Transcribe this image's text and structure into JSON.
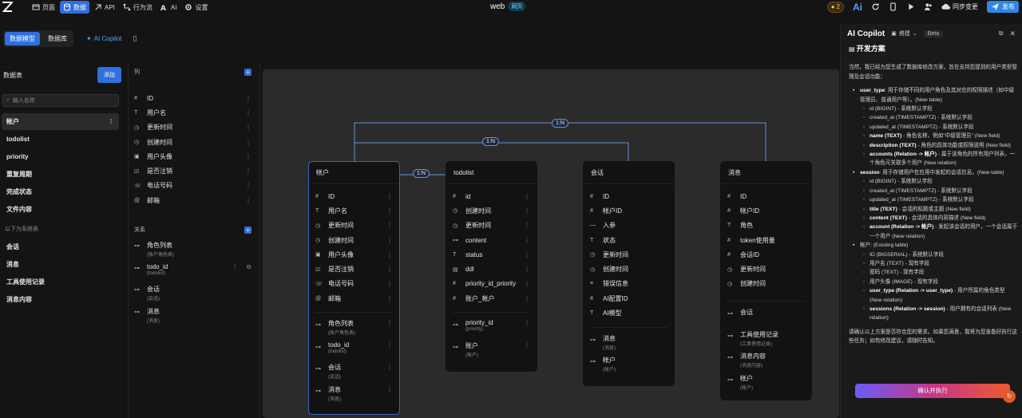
{
  "nav": {
    "items": [
      {
        "label": "页面",
        "icon": "page-icon"
      },
      {
        "label": "数据",
        "icon": "database-icon"
      },
      {
        "label": "API",
        "icon": "api-icon"
      },
      {
        "label": "行为流",
        "icon": "flow-icon"
      },
      {
        "label": "AI",
        "icon": "ai-icon"
      },
      {
        "label": "设置",
        "icon": "gear-icon"
      }
    ],
    "active_index": 1
  },
  "app": {
    "name": "web",
    "badge": "网页"
  },
  "toolbar": {
    "credits": "2",
    "ai": "Ai",
    "sync_label": "同步变更",
    "publish_label": "发布"
  },
  "subtabs": {
    "model": "数据模型",
    "db": "数据库",
    "copilot": "AI Copilot"
  },
  "sidebar": {
    "title": "数据表",
    "add_label": "添加",
    "search_placeholder": "输入名称",
    "tables": [
      "帐户",
      "todolist",
      "priority",
      "重复周期",
      "完成状态",
      "文件内容"
    ],
    "system_label": "以下为系统表",
    "system_tables": [
      "会话",
      "消息",
      "工具使用记录",
      "消息内容"
    ]
  },
  "columns_panel": {
    "title": "列",
    "fields": [
      {
        "icon": "#",
        "name": "ID"
      },
      {
        "icon": "T",
        "name": "用户名"
      },
      {
        "icon": "◷",
        "name": "更新时间"
      },
      {
        "icon": "◷",
        "name": "创建时间"
      },
      {
        "icon": "▣",
        "name": "用户头像"
      },
      {
        "icon": "☑",
        "name": "是否注销"
      },
      {
        "icon": "☏",
        "name": "电话号码"
      },
      {
        "icon": "@",
        "name": "邮箱"
      }
    ],
    "relations_title": "关系",
    "relations": [
      {
        "name": "角色列表",
        "sub": "(账户角色表)"
      },
      {
        "name": "todo_id",
        "sub": "(todolist)"
      },
      {
        "name": "会话",
        "sub": "(会话)"
      },
      {
        "name": "消息",
        "sub": "(消息)"
      }
    ]
  },
  "edges": [
    "1:N",
    "1:N",
    "1:N"
  ],
  "cards": {
    "account": {
      "title": "帐户",
      "fields": [
        "ID",
        "用户名",
        "更新时间",
        "创建时间",
        "用户头像",
        "是否注销",
        "电话号码",
        "邮箱"
      ],
      "relations": [
        {
          "name": "角色列表",
          "sub": "(账户角色表)"
        },
        {
          "name": "todo_id",
          "sub": "(todolist)"
        },
        {
          "name": "会话",
          "sub": "(会话)"
        },
        {
          "name": "消息",
          "sub": "(消息)"
        }
      ]
    },
    "todolist": {
      "title": "todolist",
      "fields": [
        "id",
        "创建时间",
        "更新时间",
        "content",
        "status",
        "ddl",
        "priority_id_priority",
        "账户_帐户"
      ],
      "relations": [
        {
          "name": "priority_id",
          "sub": "(priority)"
        },
        {
          "name": "账户",
          "sub": "(帐户)"
        }
      ]
    },
    "session": {
      "title": "会话",
      "fields": [
        "ID",
        "帐户ID",
        "入参",
        "状态",
        "更新时间",
        "创建时间",
        "错误信息",
        "AI配置ID",
        "AI模型"
      ],
      "relations": [
        {
          "name": "消息",
          "sub": "(消息)"
        },
        {
          "name": "帐户",
          "sub": "(帐户)"
        }
      ]
    },
    "message": {
      "title": "消息",
      "fields": [
        "ID",
        "帐户ID",
        "角色",
        "token使用量",
        "会话ID",
        "更新时间",
        "创建时间"
      ],
      "relations": [
        {
          "name": "会话",
          "sub": ""
        },
        {
          "name": "工具使用记录",
          "sub": "(工具使用记录)"
        },
        {
          "name": "消息内容",
          "sub": "(消息内容)"
        },
        {
          "name": "帐户",
          "sub": "(帐户)"
        }
      ]
    }
  },
  "copilot": {
    "title": "AI Copilot",
    "mode": "搭建",
    "beta": "Beta",
    "heading": "开发方案",
    "intro": "当然，我已经为您生成了数据库修改方案，旨在支持您提到的用户类型管理及会话功能：",
    "ut_name": "user_type",
    "ut_desc": ": 用于存储不同的用户角色及其对应的权限描述（如中级管理员、普通用户等）。(New table)",
    "ut_items": [
      "id (BIGINT) - 系统默认字段",
      "created_at (TIMESTAMPTZ) - 系统默认字段",
      "updated_at (TIMESTAMPTZ) - 系统默认字段"
    ],
    "ut_name_field": "name (TEXT)",
    "ut_name_desc": " - 角色名称，例如\"中级管理员\" (New field)",
    "ut_desc_field": "description (TEXT)",
    "ut_desc_desc": " - 角色的具体功能或权限说明 (New field)",
    "ut_acc_field": "accounts (Relation -> 帐户)",
    "ut_acc_desc": " - 属于该角色的所有用户列表，一个角色可关联多个用户 (New relation)",
    "ss_name": "session",
    "ss_desc": ": 用于存储用户在应用中发起的会话信息。(New table)",
    "ss_items": [
      "id (BIGINT) - 系统默认字段",
      "created_at (TIMESTAMPTZ) - 系统默认字段",
      "updated_at (TIMESTAMPTZ) - 系统默认字段"
    ],
    "ss_title_field": "title (TEXT)",
    "ss_title_desc": " - 会话的标题或主题 (New field)",
    "ss_content_field": "content (TEXT)",
    "ss_content_desc": " - 会话的具体内容描述 (New field)",
    "ss_acc_field": "account (Relation -> 帐户)",
    "ss_acc_desc": " - 发起该会话的用户，一个会话属于一个用户 (New relation)",
    "ac_name": "帐户: (Existing table)",
    "ac_items": [
      "ID (BIGSERIAL) - 系统默认字段",
      "用户名 (TEXT) - 现有字段",
      "密码 (TEXT) - 现有字段",
      "用户头像 (IMAGE) - 现有字段"
    ],
    "ac_ut_field": "user_type (Relation -> user_type)",
    "ac_ut_desc": " - 用户所属的角色类型 (New relation)",
    "ac_ss_field": "sessions (Relation -> session)",
    "ac_ss_desc": " - 用户拥有的会话列表 (New relation)",
    "outro": "请确认以上方案是否符合您的需求。如果您满意，我将为您准备好执行这些任务；如有修改建议，请随时告知。",
    "confirm_label": "确认并执行"
  }
}
